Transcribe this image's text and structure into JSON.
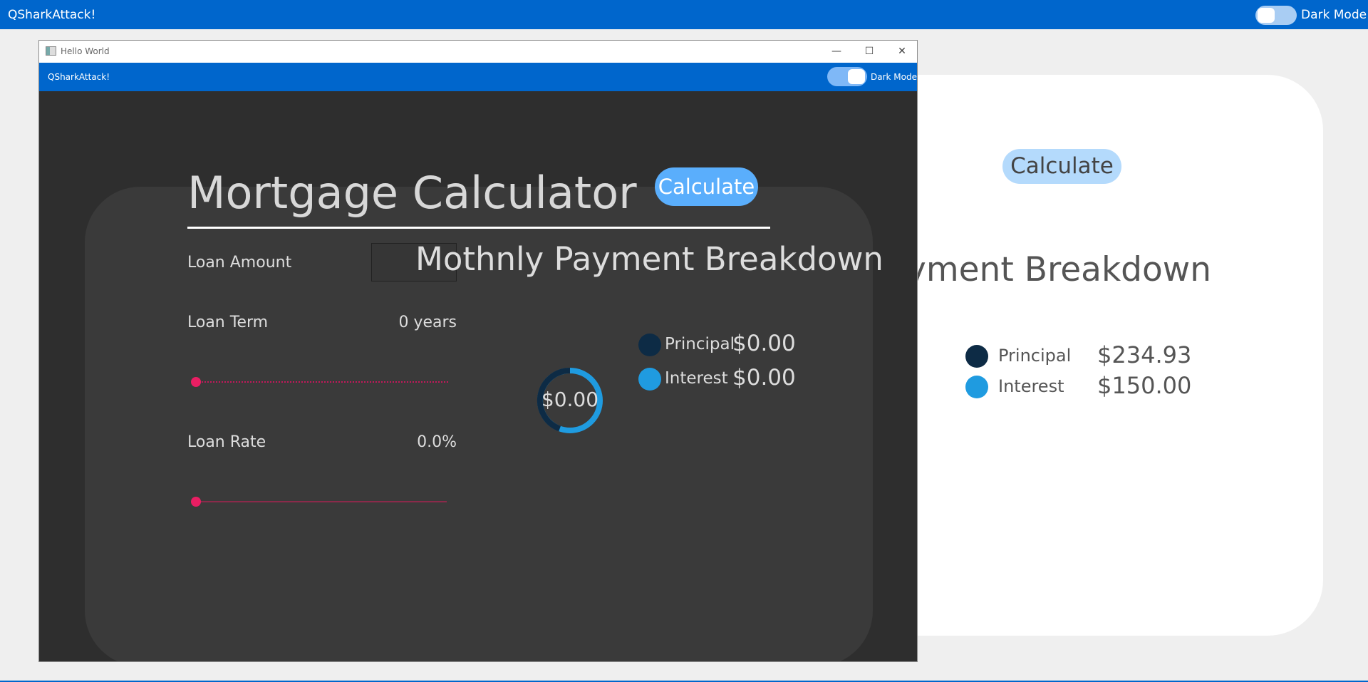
{
  "background_app": {
    "title": "QSharkAttack!",
    "dark_mode_label": "Dark Mode",
    "dark_mode_on": false,
    "calculate_label": "Calculate",
    "breakdown_heading_visible": "yment Breakdown",
    "legend": [
      {
        "label": "Principal",
        "value": "$234.93",
        "color": "#0d2b45"
      },
      {
        "label": "Interest",
        "value": "$150.00",
        "color": "#1f9be0"
      }
    ]
  },
  "window": {
    "title": "Hello World",
    "controls": {
      "minimize": "—",
      "maximize": "☐",
      "close": "✕"
    },
    "appbar": {
      "title": "QSharkAttack!",
      "dark_mode_label": "Dark Mode",
      "dark_mode_on": true
    },
    "calculator": {
      "heading": "Mortgage Calculator",
      "calculate_label": "Calculate",
      "loan_amount_label": "Loan Amount",
      "loan_amount_value": "",
      "loan_term_label": "Loan Term",
      "loan_term_value": "0 years",
      "loan_rate_label": "Loan Rate",
      "loan_rate_value": "0.0%",
      "breakdown_heading": "Mothnly Payment Breakdown",
      "donut_total": "$0.00",
      "legend": [
        {
          "label": "Principal",
          "value": "$0.00",
          "color": "#0d2b45"
        },
        {
          "label": "Interest",
          "value": "$0.00",
          "color": "#1f9be0"
        }
      ]
    }
  },
  "colors": {
    "accent_blue": "#0066cc",
    "button_blue": "#5aaefc",
    "slider_pink": "#e91e63",
    "dark_bg": "#2e2e2e",
    "card_bg": "#3a3a3a"
  }
}
